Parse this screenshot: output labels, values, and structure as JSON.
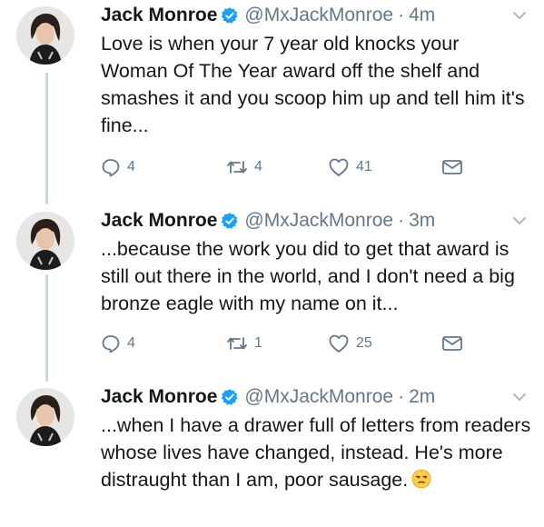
{
  "author": {
    "name": "Jack Monroe",
    "handle": "@MxJackMonroe"
  },
  "tweets": [
    {
      "time": "4m",
      "text": "Love is when your 7 year old knocks your Woman Of The Year award off the shelf and smashes it and you scoop him up and tell him it's fine...",
      "replies": "4",
      "retweets": "4",
      "likes": "41"
    },
    {
      "time": "3m",
      "text": "...because the work you did to get that award is still out there in the world, and I don't need a big bronze eagle with my name on it...",
      "replies": "4",
      "retweets": "1",
      "likes": "25"
    },
    {
      "time": "2m",
      "text": "...when I have a drawer full of letters from readers whose lives have changed, instead. He's more distraught than I am, poor sausage.",
      "emoji": "unamused-face-emoji"
    }
  ],
  "colors": {
    "verified": "#1da1f2",
    "muted": "#657786",
    "thread_line": "#ccd6dd"
  }
}
